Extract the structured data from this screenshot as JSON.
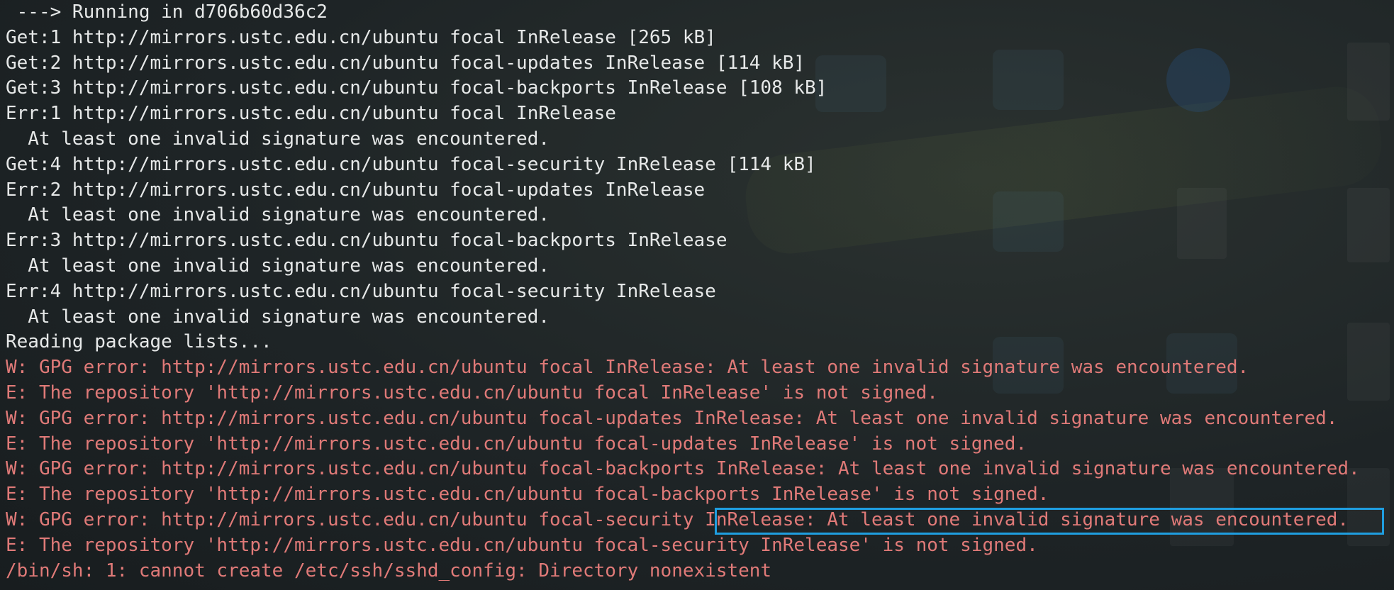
{
  "terminal": {
    "lines": [
      {
        "text": " ---> Running in d706b60d36c2",
        "style": "normal"
      },
      {
        "text": "Get:1 http://mirrors.ustc.edu.cn/ubuntu focal InRelease [265 kB]",
        "style": "normal"
      },
      {
        "text": "Get:2 http://mirrors.ustc.edu.cn/ubuntu focal-updates InRelease [114 kB]",
        "style": "normal"
      },
      {
        "text": "Get:3 http://mirrors.ustc.edu.cn/ubuntu focal-backports InRelease [108 kB]",
        "style": "normal"
      },
      {
        "text": "Err:1 http://mirrors.ustc.edu.cn/ubuntu focal InRelease",
        "style": "normal"
      },
      {
        "text": "  At least one invalid signature was encountered.",
        "style": "normal"
      },
      {
        "text": "Get:4 http://mirrors.ustc.edu.cn/ubuntu focal-security InRelease [114 kB]",
        "style": "normal"
      },
      {
        "text": "Err:2 http://mirrors.ustc.edu.cn/ubuntu focal-updates InRelease",
        "style": "normal"
      },
      {
        "text": "  At least one invalid signature was encountered.",
        "style": "normal"
      },
      {
        "text": "Err:3 http://mirrors.ustc.edu.cn/ubuntu focal-backports InRelease",
        "style": "normal"
      },
      {
        "text": "  At least one invalid signature was encountered.",
        "style": "normal"
      },
      {
        "text": "Err:4 http://mirrors.ustc.edu.cn/ubuntu focal-security InRelease",
        "style": "normal"
      },
      {
        "text": "  At least one invalid signature was encountered.",
        "style": "normal"
      },
      {
        "text": "Reading package lists...",
        "style": "normal"
      },
      {
        "text": "W: GPG error: http://mirrors.ustc.edu.cn/ubuntu focal InRelease: At least one invalid signature was encountered.",
        "style": "warn"
      },
      {
        "text": "E: The repository 'http://mirrors.ustc.edu.cn/ubuntu focal InRelease' is not signed.",
        "style": "warn"
      },
      {
        "text": "W: GPG error: http://mirrors.ustc.edu.cn/ubuntu focal-updates InRelease: At least one invalid signature was encountered.",
        "style": "warn"
      },
      {
        "text": "E: The repository 'http://mirrors.ustc.edu.cn/ubuntu focal-updates InRelease' is not signed.",
        "style": "warn"
      },
      {
        "text": "W: GPG error: http://mirrors.ustc.edu.cn/ubuntu focal-backports InRelease: At least one invalid signature was encountered.",
        "style": "warn"
      },
      {
        "text": "E: The repository 'http://mirrors.ustc.edu.cn/ubuntu focal-backports InRelease' is not signed.",
        "style": "warn"
      },
      {
        "text": "W: GPG error: http://mirrors.ustc.edu.cn/ubuntu focal-security InRelease: At least one invalid signature was encountered.",
        "style": "warn"
      },
      {
        "text": "E: The repository 'http://mirrors.ustc.edu.cn/ubuntu focal-security InRelease' is not signed.",
        "style": "warn"
      },
      {
        "text": "/bin/sh: 1: cannot create /etc/ssh/sshd_config: Directory nonexistent",
        "style": "warn"
      }
    ],
    "highlighted_text": "InRelease: At least one invalid signature was encountered."
  },
  "colors": {
    "background": "#1f2426",
    "text": "#e6e8e8",
    "warning_text": "#e07a78",
    "highlight_border": "#1f9ee0"
  }
}
